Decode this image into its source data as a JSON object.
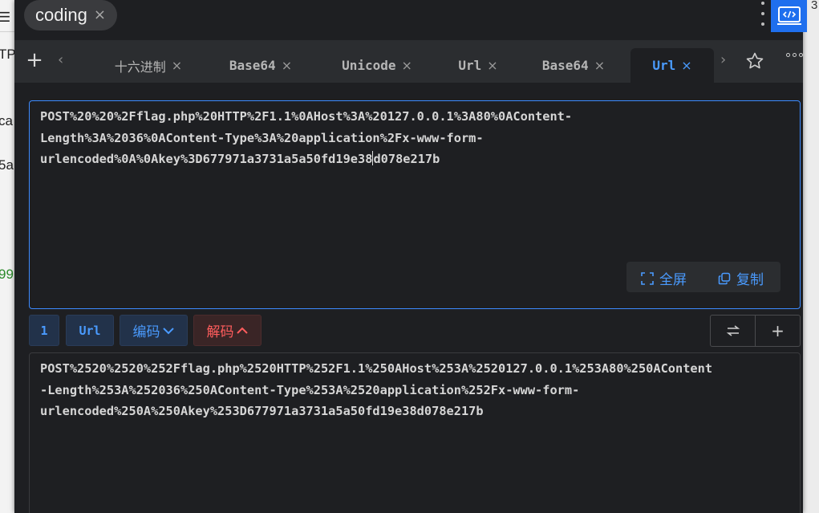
{
  "background": {
    "left_fragments": [
      "☰",
      "TP",
      "ca",
      "5a",
      "99"
    ],
    "right_fragment": "3"
  },
  "window": {
    "title_chip": "coding",
    "chip_close": "×"
  },
  "tabs": {
    "add": "+",
    "prev": "‹",
    "next": "›",
    "close": "×",
    "items": [
      {
        "label": "十六进制",
        "active": false
      },
      {
        "label": "Base64",
        "active": false
      },
      {
        "label": "Unicode",
        "active": false
      },
      {
        "label": "Url",
        "active": false
      },
      {
        "label": "Base64",
        "active": false
      },
      {
        "label": "Url",
        "active": true
      }
    ]
  },
  "input": {
    "lines": [
      "POST%20%20%2Fflag.php%20HTTP%2F1.1%0AHost%3A%20127.0.0.1%3A80%0AContent-",
      "Length%3A%2036%0AContent-Type%3A%20application%2Fx-www-form-"
    ],
    "line3_before_caret": "urlencoded%0A%0Akey%3D677971a3731a5a50fd19e38",
    "line3_after_caret": "d078e217b",
    "fullscreen_label": "全屏",
    "copy_label": "复制"
  },
  "toolbar": {
    "step": "1",
    "mode": "Url",
    "encode_label": "编码",
    "decode_label": "解码",
    "add": "+"
  },
  "output": {
    "lines": [
      "POST%2520%2520%252Fflag.php%2520HTTP%252F1.1%250AHost%253A%2520127.0.0.1%253A80%250AContent",
      "-Length%253A%252036%250AContent-Type%253A%2520application%252Fx-www-form-",
      "urlencoded%250A%250Akey%253D677971a3731a5a50fd19e38d078e217b"
    ]
  },
  "colors": {
    "accent": "#4a9bff",
    "decode": "#ff5d5d",
    "panel": "#1e1f22",
    "tabbar": "#2b2d30",
    "app_icon": "#1f6fee"
  }
}
